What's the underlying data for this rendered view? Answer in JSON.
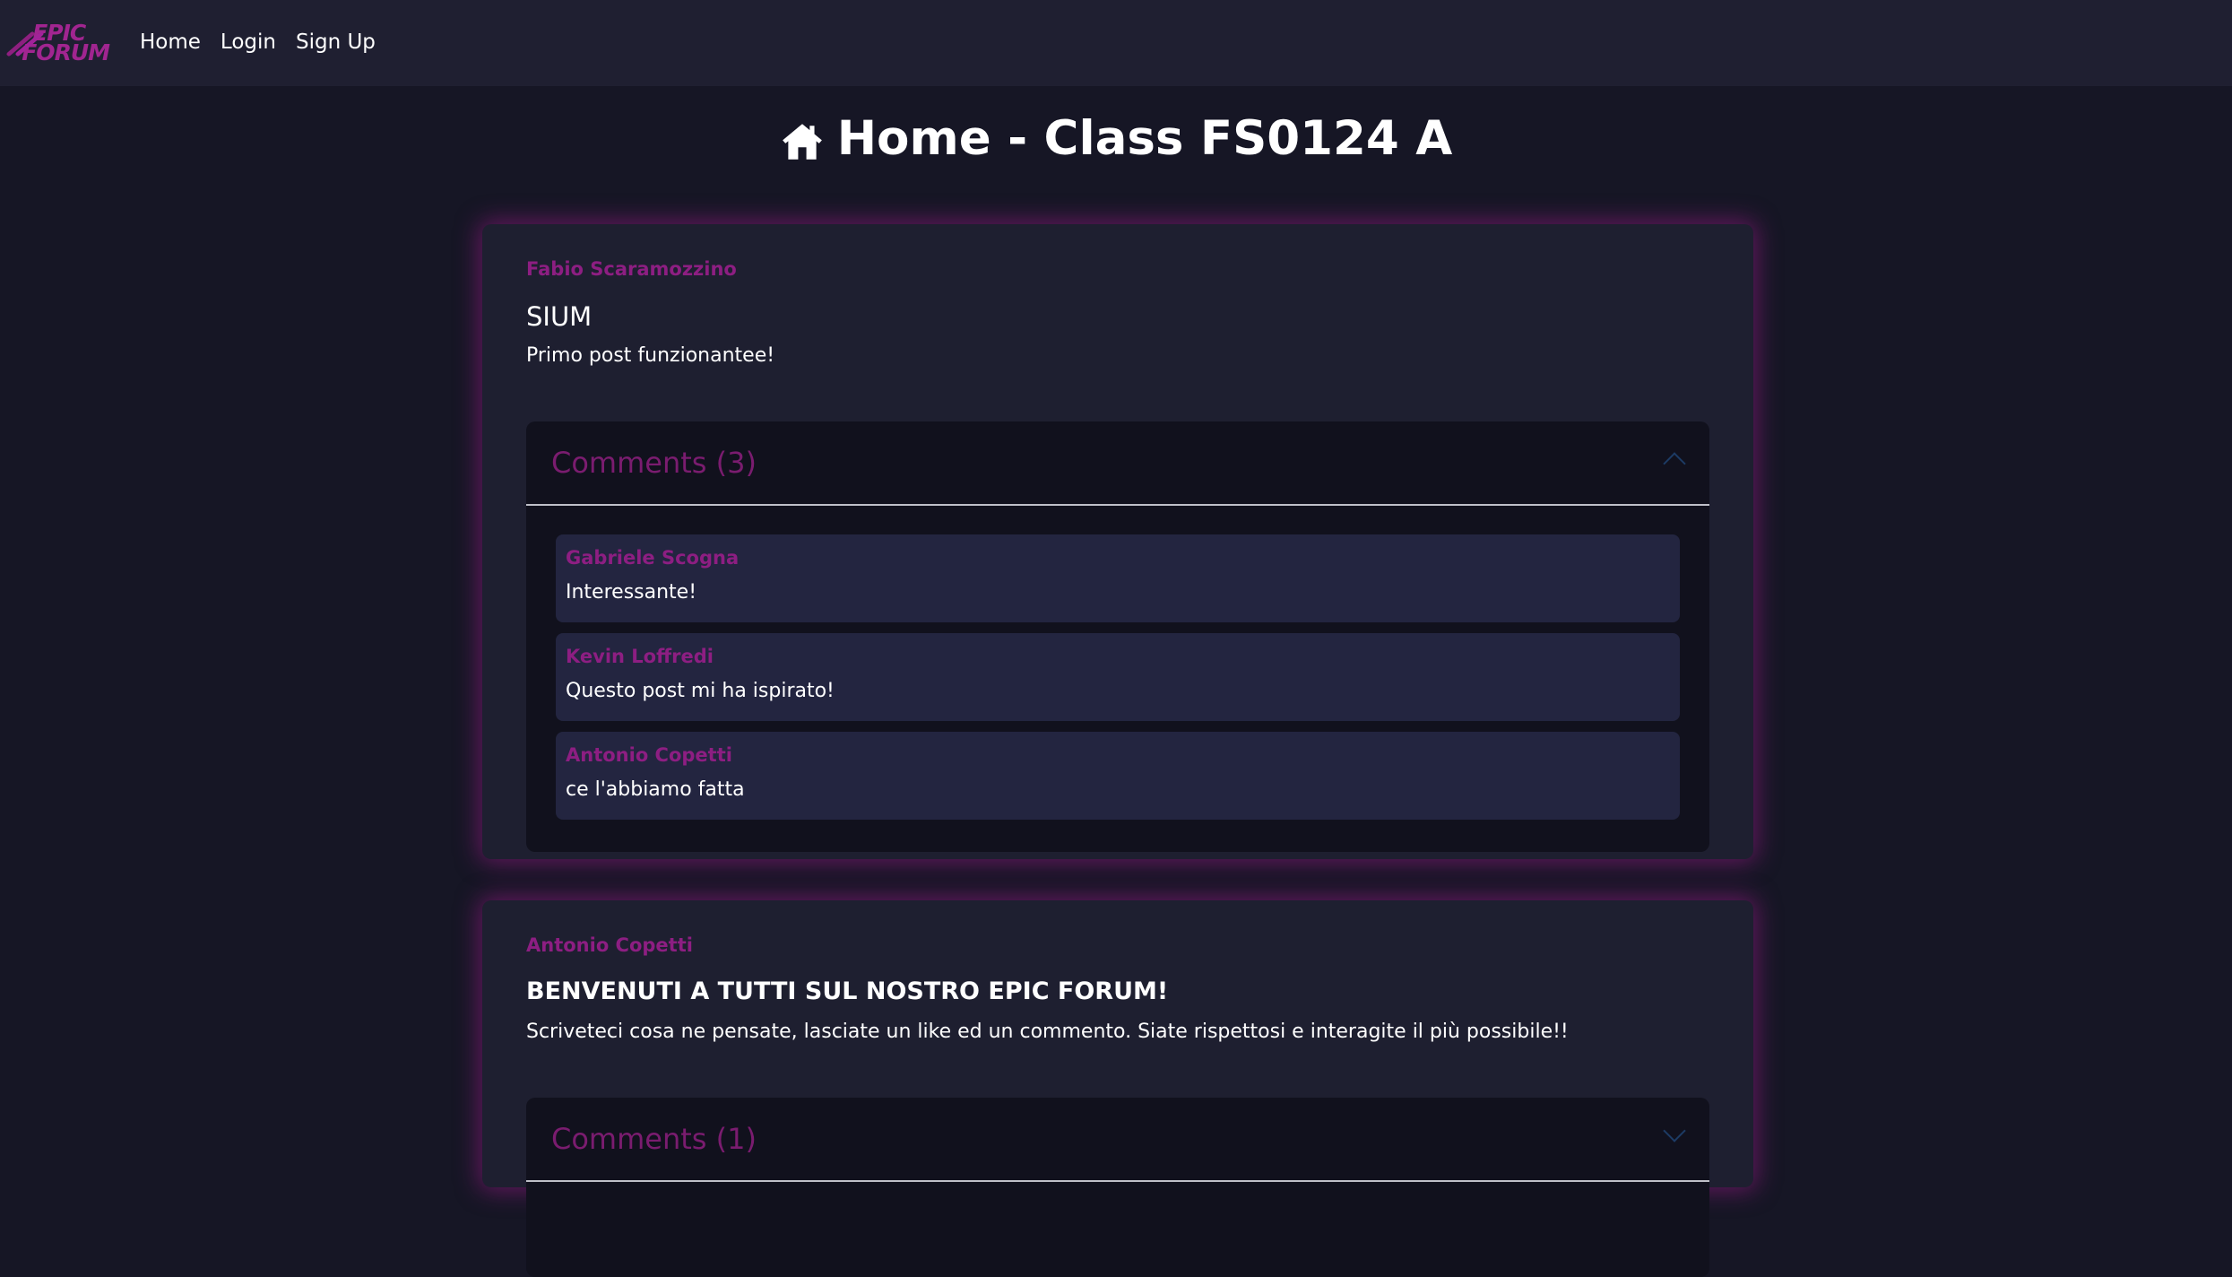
{
  "brand": {
    "logo_line1": "EPIC",
    "logo_line2": "FORUM",
    "accent_color": "#8d1e82"
  },
  "nav": {
    "items": [
      {
        "label": "Home"
      },
      {
        "label": "Login"
      },
      {
        "label": "Sign Up"
      }
    ]
  },
  "page": {
    "title": "Home - Class FS0124 A",
    "title_icon": "home-icon"
  },
  "posts": [
    {
      "author": "Fabio Scaramozzino",
      "title": "SIUM",
      "body": "Primo post funzionantee!",
      "comments_label": "Comments (3)",
      "comments": [
        {
          "author": "Gabriele Scogna",
          "text": "Interessante!"
        },
        {
          "author": "Kevin Loffredi",
          "text": "Questo post mi ha ispirato!"
        },
        {
          "author": "Antonio Copetti",
          "text": "ce l'abbiamo fatta"
        }
      ]
    },
    {
      "author": "Antonio Copetti",
      "title": "BENVENUTI A TUTTI SUL NOSTRO EPIC FORUM!",
      "body": "Scriveteci cosa ne pensate, lasciate un like ed un commento. Siate rispettosi e interagite il più possibile!!",
      "comments_label": "Comments (1)"
    }
  ]
}
